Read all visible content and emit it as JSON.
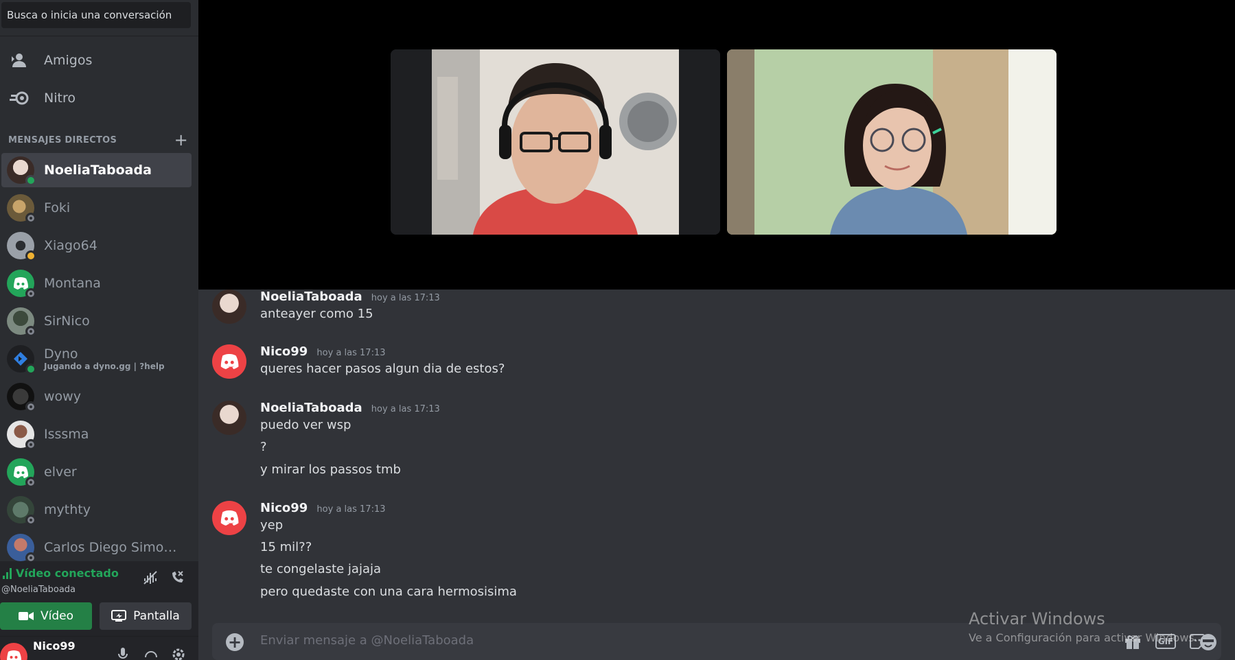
{
  "search": {
    "placeholder": "Busca o inicia una conversación"
  },
  "nav": [
    {
      "label": "Amigos",
      "icon": "friends-icon"
    },
    {
      "label": "Nitro",
      "icon": "nitro-icon"
    }
  ],
  "dm_header": {
    "title": "MENSAJES DIRECTOS",
    "add": "+"
  },
  "dms": [
    {
      "name": "NoeliaTaboada",
      "status": "online",
      "active": true
    },
    {
      "name": "Foki",
      "status": "offline"
    },
    {
      "name": "Xiago64",
      "status": "idle"
    },
    {
      "name": "Montana",
      "status": "offline"
    },
    {
      "name": "SirNico",
      "status": "offline"
    },
    {
      "name": "Dyno",
      "status": "online",
      "activity": "Jugando a dyno.gg | ?help"
    },
    {
      "name": "wowy",
      "status": "offline"
    },
    {
      "name": "Isssma",
      "status": "offline"
    },
    {
      "name": "elver",
      "status": "offline"
    },
    {
      "name": "mythty",
      "status": "offline"
    },
    {
      "name": "Carlos Diego Simon H...",
      "status": "offline"
    }
  ],
  "voice": {
    "status": "Vídeo conectado",
    "channel": "@NoeliaTaboada",
    "video_label": "Vídeo",
    "screen_label": "Pantalla"
  },
  "user": {
    "name": "Nico99"
  },
  "messages": [
    {
      "author": "NoeliaTaboada",
      "time": "hoy a las 17:13",
      "lines": [
        "anteayer como 15"
      ]
    },
    {
      "author": "Nico99",
      "time": "hoy a las 17:13",
      "lines": [
        "queres hacer pasos algun dia de estos?"
      ]
    },
    {
      "author": "NoeliaTaboada",
      "time": "hoy a las 17:13",
      "lines": [
        "puedo ver wsp",
        "?",
        "y mirar los passos tmb"
      ]
    },
    {
      "author": "Nico99",
      "time": "hoy a las 17:13",
      "lines": [
        "yep",
        "15 mil??",
        "te congelaste jajaja",
        "pero quedaste con una cara hermosisima"
      ]
    }
  ],
  "composer": {
    "placeholder": "Enviar mensaje a @NoeliaTaboada",
    "gif": "GIF"
  },
  "watermark": {
    "title": "Activar Windows",
    "subtitle": "Ve a Configuración para activar Windows."
  },
  "colors": {
    "online": "#23a55a",
    "idle": "#f0b232",
    "discord_red": "#ed4245",
    "discord_green": "#23a55a"
  }
}
